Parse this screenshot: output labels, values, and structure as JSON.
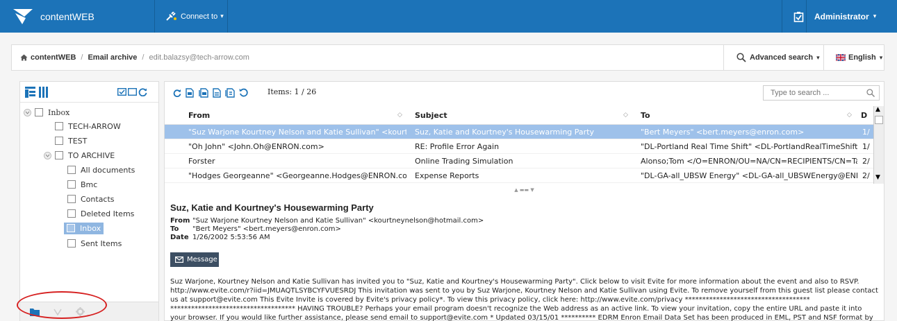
{
  "topbar": {
    "brand": "contentWEB",
    "connect_label": "Connect to",
    "admin_label": "Administrator",
    "color": "#1c73b8"
  },
  "breadcrumb": {
    "home": "contentWEB",
    "section": "Email archive",
    "current": "edit.balazsy@tech-arrow.com"
  },
  "advanced_search": "Advanced search",
  "language": "English",
  "tree": {
    "inbox": "Inbox",
    "tech_arrow": "TECH-ARROW",
    "test": "TEST",
    "to_archive": "TO ARCHIVE",
    "all_documents": "All documents",
    "bmc": "Bmc",
    "contacts": "Contacts",
    "deleted_items": "Deleted Items",
    "inbox_sub": "Inbox",
    "sent_items": "Sent Items"
  },
  "toolbar": {
    "items_label": "Items: 1 / 26",
    "search_placeholder": "Type to search ..."
  },
  "grid": {
    "columns": {
      "from": "From",
      "subject": "Subject",
      "to": "To",
      "date": "D"
    },
    "rows": [
      {
        "from": "\"Suz Warjone Kourtney Nelson and Katie Sullivan\" <kourtney",
        "subject": "Suz, Katie and Kourtney's Housewarming Party",
        "to": "\"Bert Meyers\" <bert.meyers@enron.com>",
        "date": "1/"
      },
      {
        "from": "\"Oh John\" <John.Oh@ENRON.com>",
        "subject": "RE: Profile Error Again",
        "to": "\"DL-Portland Real Time Shift\" <DL-PortlandRealTimeShift@EN",
        "date": "1/"
      },
      {
        "from": "Forster",
        "subject": "Online Trading Simulation",
        "to": "Alonso;Tom </O=ENRON/OU=NA/CN=RECIPIENTS/CN=Talon",
        "date": "2/"
      },
      {
        "from": "\"Hodges Georgeanne\" <Georgeanne.Hodges@ENRON.com>",
        "subject": "Expense Reports",
        "to": "\"DL-GA-all_UBSW Energy\" <DL-GA-all_UBSWEnergy@ENRON.",
        "date": "2/"
      }
    ]
  },
  "preview": {
    "subject": "Suz, Katie and Kourtney's Housewarming Party",
    "from_label": "From",
    "from": "\"Suz Warjone Kourtney Nelson and Katie Sullivan\" <kourtneynelson@hotmail.com>",
    "to_label": "To",
    "to": "\"Bert Meyers\" <bert.meyers@enron.com>",
    "date_label": "Date",
    "date": "1/26/2002 5:53:56 AM",
    "message_button": "Message",
    "body": "Suz Warjone, Kourtney Nelson and Katie Sullivan has invited you to \"Suz, Katie and Kourtney's Housewarming Party\". Click below to visit Evite for more information about the event and also to RSVP. http://www.evite.com/r?iid=JMUAQTLSYBCYFVUESRDJ This invitation was sent to you by Suz Warjone, Kourtney Nelson and Katie Sullivan using Evite. To remove yourself from this guest list please contact us at support@evite.com This Evite Invite is covered by Evite's privacy policy*. To view this privacy policy, click here: http://www.evite.com/privacy ************************************ ************************************ HAVING TROUBLE? Perhaps your email program doesn't recognize the Web address as an active link. To view your invitation, copy the entire URL and paste it into your browser. If you would like further assistance, please send email to support@evite.com * Updated 03/15/01 ********** EDRM Enron Email Data Set has been produced in EML, PST and NSF format by ZL"
  }
}
